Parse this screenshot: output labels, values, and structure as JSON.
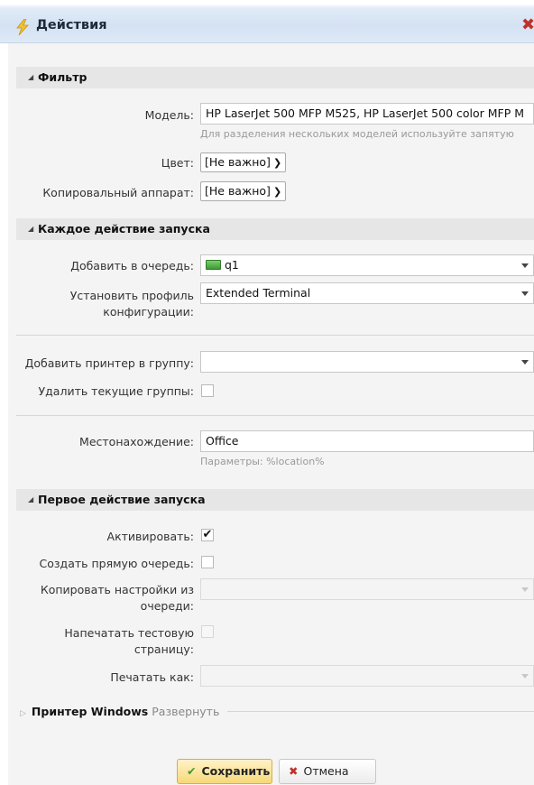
{
  "window": {
    "title": "Действия",
    "lightning_icon": "lightning-icon",
    "close_icon": "close-icon"
  },
  "filter": {
    "header": "Фильтр",
    "model_label": "Модель:",
    "model_value": "HP LaserJet 500 MFP M525, HP LaserJet 500 color MFP M",
    "model_hint": "Для разделения нескольких моделей используйте запятую",
    "color_label": "Цвет:",
    "color_value": "[Не важно]",
    "copier_label": "Копировальный аппарат:",
    "copier_value": "[Не важно]"
  },
  "each_run": {
    "header": "Каждое действие запуска",
    "queue_label": "Добавить в очередь:",
    "queue_value": "q1",
    "profile_label_1": "Установить профиль",
    "profile_label_2": "конфигурации:",
    "profile_value": "Extended Terminal",
    "group_label": "Добавить принтер в группу:",
    "group_value": "",
    "remove_groups_label": "Удалить текущие группы:",
    "remove_groups_checked": false,
    "location_label": "Местонахождение:",
    "location_value": "Office",
    "location_hint": "Параметры: %location%"
  },
  "first_run": {
    "header": "Первое действие запуска",
    "activate_label": "Активировать:",
    "activate_mark": "✔",
    "activate_checked": true,
    "direct_queue_label": "Создать прямую очередь:",
    "direct_queue_checked": false,
    "copy_settings_label_1": "Копировать настройки из",
    "copy_settings_label_2": "очереди:",
    "test_page_label_1": "Напечатать тестовую",
    "test_page_label_2": "страницу:",
    "test_page_checked": false,
    "print_as_label": "Печатать как:"
  },
  "windows_printer": {
    "name": "Принтер Windows",
    "expand": "Развернуть"
  },
  "buttons": {
    "save": "Сохранить",
    "cancel": "Отмена"
  },
  "colors": {
    "header_bg": "#e6e6e6",
    "save_button": "#f7d978",
    "queue_icon": "#3d9a35",
    "close_icon": "#c0302a"
  }
}
